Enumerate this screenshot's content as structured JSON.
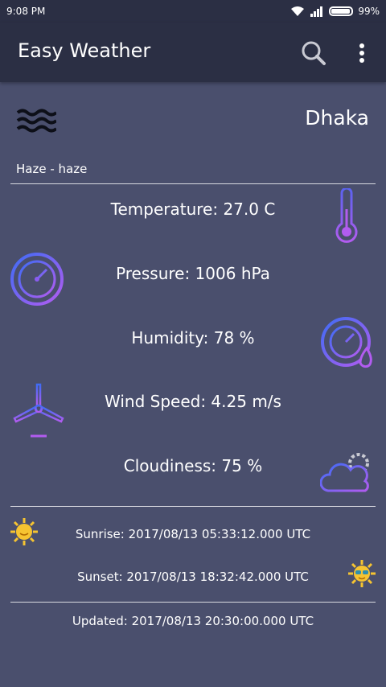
{
  "status_bar": {
    "time": "9:08 PM",
    "battery": "99%"
  },
  "app_bar": {
    "title": "Easy Weather",
    "search_icon": "search-icon",
    "menu_icon": "overflow-menu-icon"
  },
  "weather": {
    "city": "Dhaka",
    "condition": "Haze - haze",
    "temperature": "Temperature: 27.0 C",
    "pressure": "Pressure: 1006 hPa",
    "humidity": "Humidity: 78 %",
    "wind_speed": "Wind Speed: 4.25 m/s",
    "cloudiness": "Cloudiness: 75 %",
    "sunrise": "Sunrise: 2017/08/13 05:33:12.000 UTC",
    "sunset": "Sunset: 2017/08/13 18:32:42.000 UTC",
    "updated": "Updated: 2017/08/13 20:30:00.000 UTC"
  },
  "colors": {
    "app_bar": "#2b2f44",
    "background": "#4a4f6d",
    "icon_purple": "#8a5cf0",
    "icon_blue": "#3f6cf5",
    "sun_yellow": "#f6c431"
  }
}
